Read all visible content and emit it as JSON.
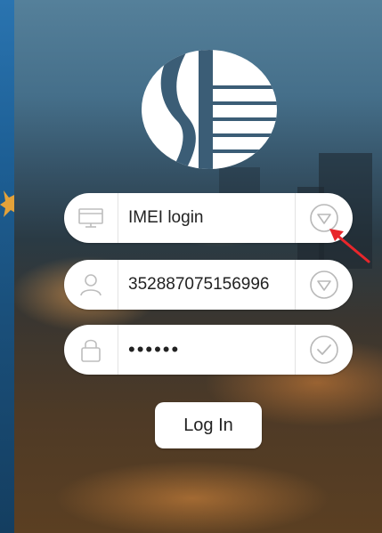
{
  "login_type": {
    "value": "IMEI login"
  },
  "account": {
    "value": "352887075156996"
  },
  "password": {
    "value": "••••••"
  },
  "login_button": {
    "label": "Log In"
  },
  "colors": {
    "field_bg": "#ffffff",
    "icon_gray": "#b8b8b8",
    "annotation_arrow": "#e8262b"
  },
  "icons": {
    "type": "monitor-icon",
    "dropdown": "dropdown-triangle-icon",
    "user": "user-icon",
    "lock": "lock-icon",
    "confirm": "check-circle-icon"
  }
}
